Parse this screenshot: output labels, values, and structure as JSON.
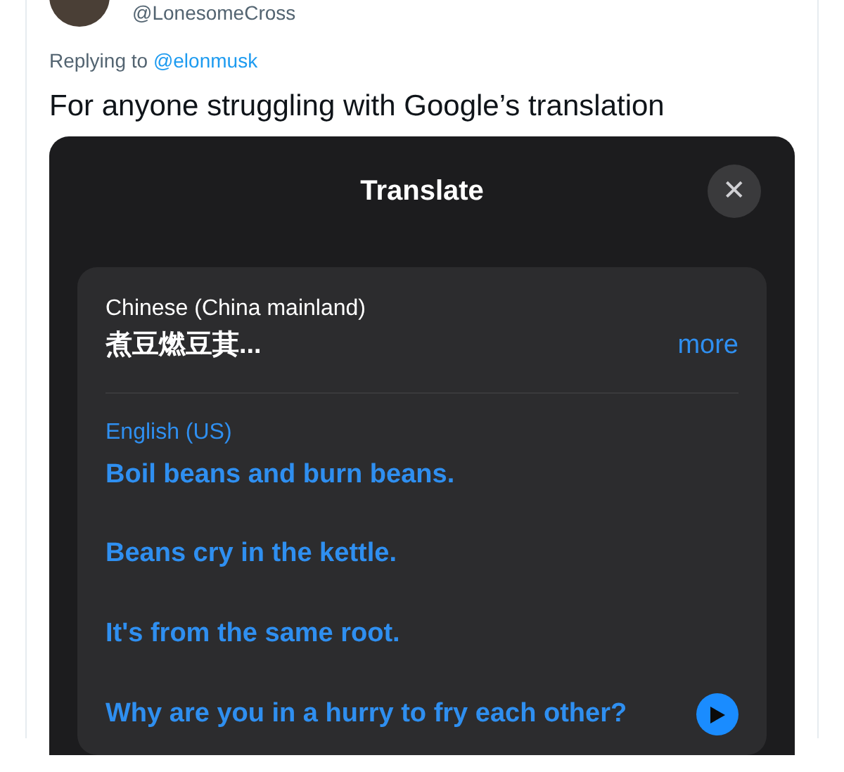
{
  "tweet": {
    "handle": "@LonesomeCross",
    "replying_label": "Replying to",
    "replying_to": "@elonmusk",
    "text": "For anyone struggling with Google’s translation"
  },
  "translate_sheet": {
    "title": "Translate",
    "close": "✕",
    "source": {
      "language": "Chinese (China mainland)",
      "text": "煮豆燃豆萁...",
      "more": "more"
    },
    "target": {
      "language": "English (US)",
      "lines": [
        "Boil beans and burn beans.",
        "Beans cry in the kettle.",
        "It's from the same root.",
        "Why are you in a hurry to fry each other?"
      ]
    }
  }
}
